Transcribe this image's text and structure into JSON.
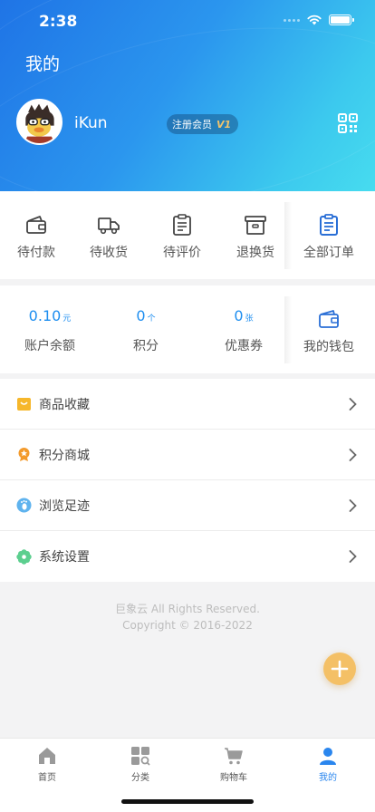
{
  "status_bar": {
    "time": "2:38"
  },
  "header": {
    "title": "我的",
    "username": "iKun",
    "member_badge": "注册会员",
    "member_level_mark": "V1"
  },
  "orders": [
    {
      "label": "待付款",
      "icon": "wallet-icon"
    },
    {
      "label": "待收货",
      "icon": "truck-icon"
    },
    {
      "label": "待评价",
      "icon": "clipboard-icon"
    },
    {
      "label": "退换货",
      "icon": "return-box-icon"
    },
    {
      "label": "全部订单",
      "icon": "order-list-icon"
    }
  ],
  "assets": [
    {
      "value": "0.10",
      "unit": "元",
      "label": "账户余额"
    },
    {
      "value": "0",
      "unit": "个",
      "label": "积分"
    },
    {
      "value": "0",
      "unit": "张",
      "label": "优惠券"
    }
  ],
  "wallet": {
    "label": "我的钱包",
    "icon": "wallet-icon"
  },
  "menu": [
    {
      "label": "商品收藏",
      "icon": "favorites-bag-icon"
    },
    {
      "label": "积分商城",
      "icon": "points-medal-icon"
    },
    {
      "label": "浏览足迹",
      "icon": "footprint-icon"
    },
    {
      "label": "系统设置",
      "icon": "settings-flower-icon"
    }
  ],
  "footer": {
    "line1": "巨象云 All Rights Reserved.",
    "line2": "Copyright © 2016-2022"
  },
  "tabbar": [
    {
      "label": "首页",
      "icon": "home-icon"
    },
    {
      "label": "分类",
      "icon": "category-icon"
    },
    {
      "label": "购物车",
      "icon": "cart-icon"
    },
    {
      "label": "我的",
      "icon": "profile-icon",
      "active": true
    }
  ],
  "colors": {
    "accent": "#2a86ee",
    "gradient_start": "#1f74e6",
    "gradient_end": "#47dcef",
    "fab": "#f4c066"
  }
}
